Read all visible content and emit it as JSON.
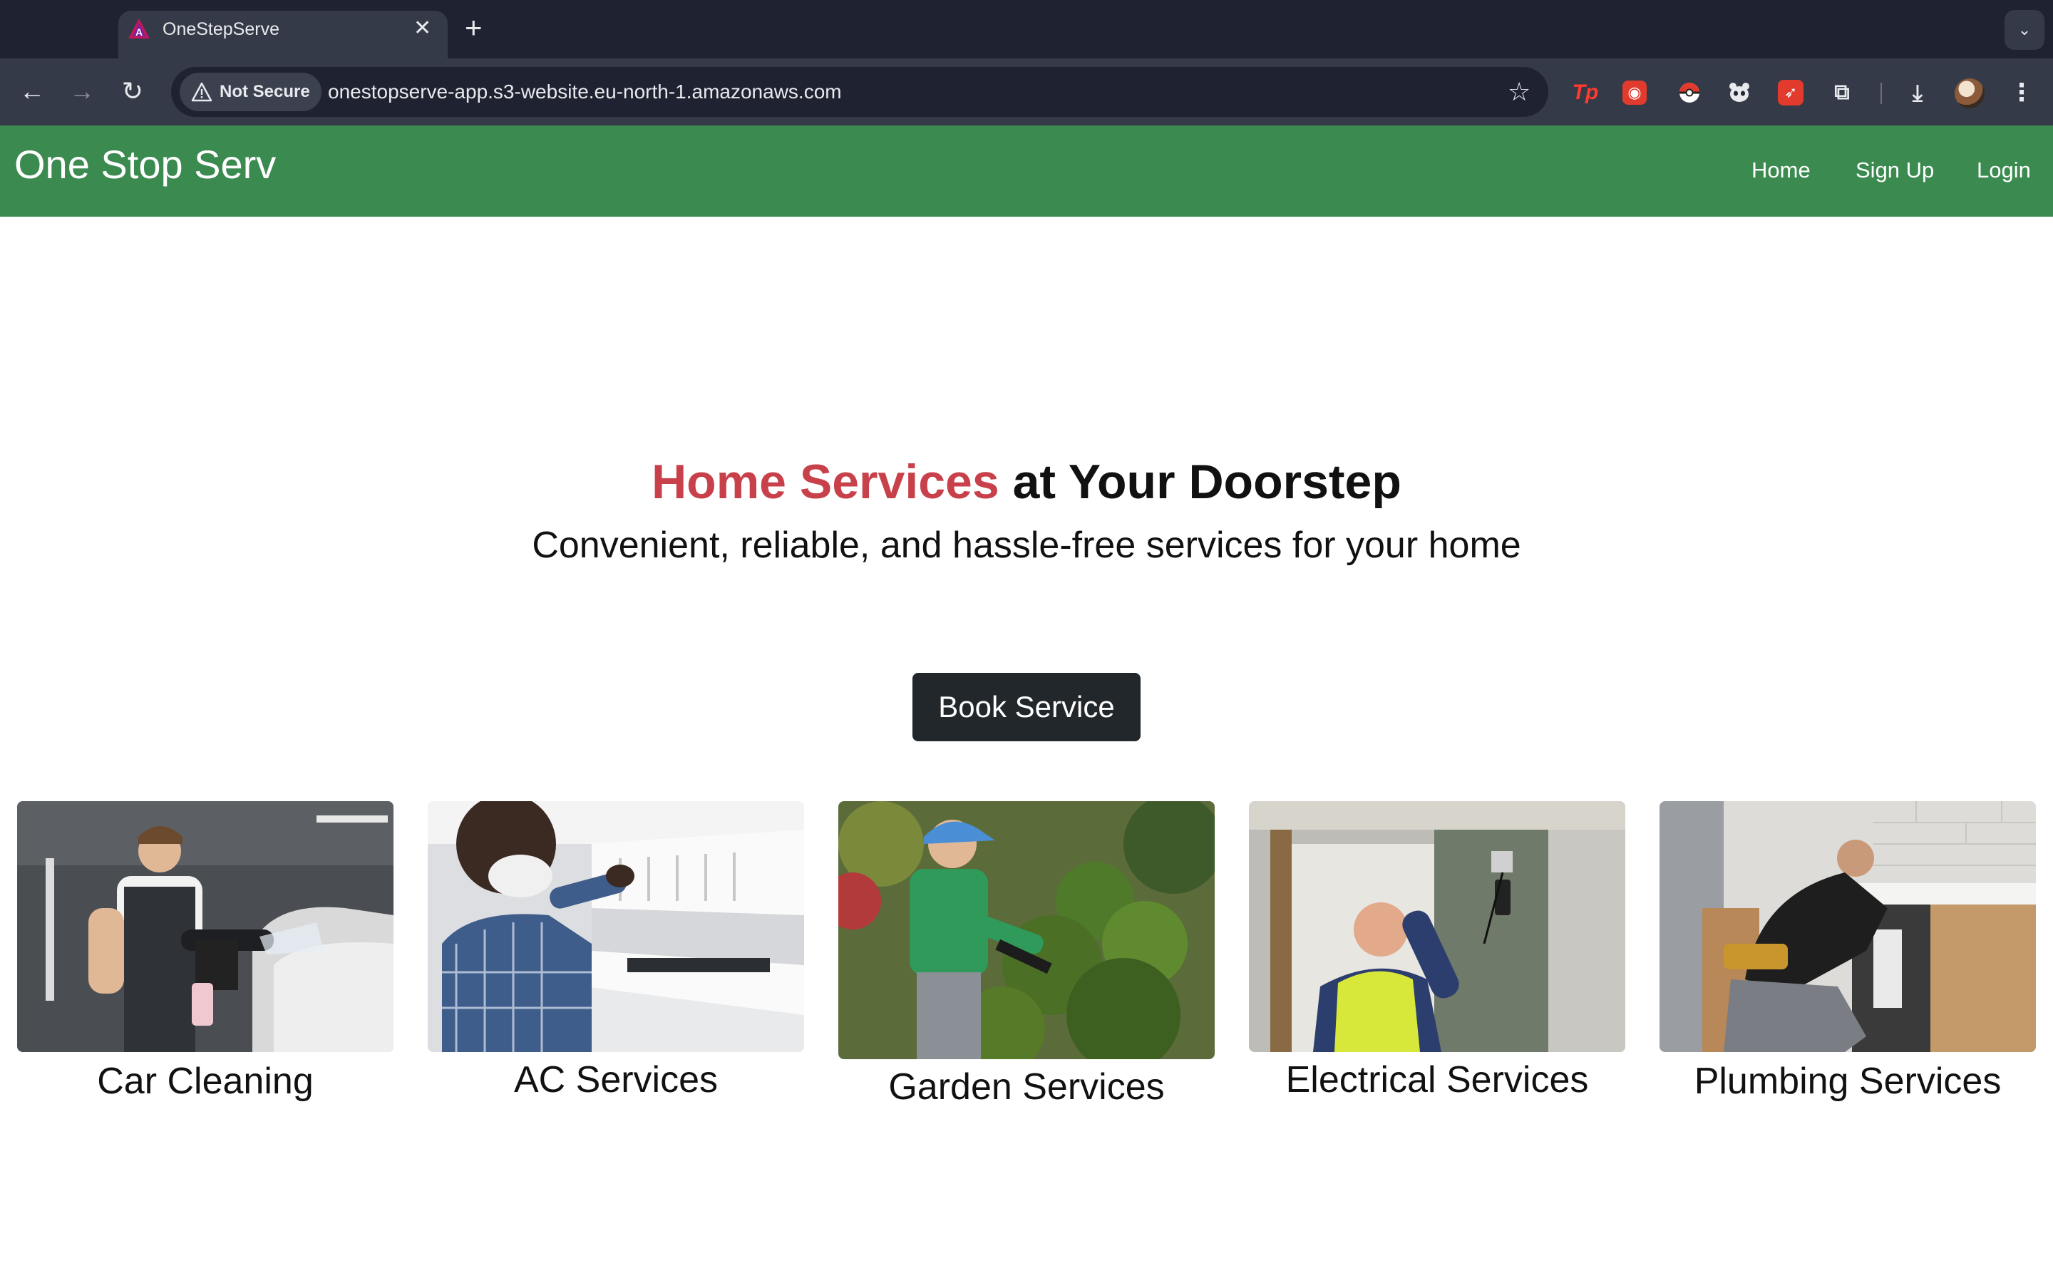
{
  "browser": {
    "tab_title": "OneStepServe",
    "security_label": "Not Secure",
    "url": "onestopserve-app.s3-website.eu-north-1.amazonaws.com",
    "extensions": [
      "tp-extension-icon",
      "red-extension-icon",
      "pokeball-extension-icon",
      "panda-extension-icon",
      "rocket-extension-icon",
      "puzzle-extensions-icon"
    ],
    "ext_tp_text": "Tp"
  },
  "site": {
    "brand": "One Stop Serv",
    "nav": {
      "home": "Home",
      "signup": "Sign Up",
      "login": "Login"
    },
    "colors": {
      "navbar": "#3b8a50",
      "accent": "#c8414a",
      "button": "#22272b"
    }
  },
  "hero": {
    "title_accent": "Home Services",
    "title_rest": " at Your Doorstep",
    "subtitle": "Convenient, reliable, and hassle-free services for your home",
    "cta": "Book Service"
  },
  "services": [
    {
      "label": "Car Cleaning"
    },
    {
      "label": "AC Services"
    },
    {
      "label": "Garden Services"
    },
    {
      "label": "Electrical Services"
    },
    {
      "label": "Plumbing Services"
    }
  ]
}
